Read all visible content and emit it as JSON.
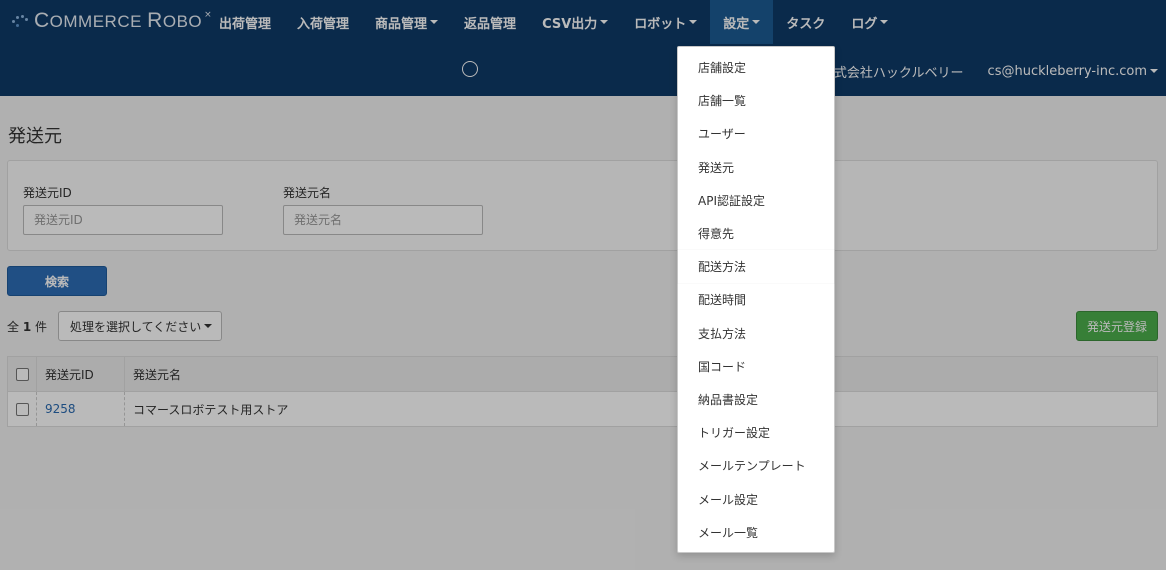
{
  "brand": {
    "name_c": "C",
    "name_rest": "OMMERCE ",
    "name_r": "R",
    "name_rest2": "OBO",
    "mark": "×"
  },
  "nav": {
    "items": [
      {
        "label": "出荷管理",
        "dropdown": false
      },
      {
        "label": "入荷管理",
        "dropdown": false
      },
      {
        "label": "商品管理",
        "dropdown": true
      },
      {
        "label": "返品管理",
        "dropdown": false
      },
      {
        "label": "CSV出力",
        "dropdown": true
      },
      {
        "label": "ロボット",
        "dropdown": true
      },
      {
        "label": "設定",
        "dropdown": true,
        "active": true
      },
      {
        "label": "タスク",
        "dropdown": false
      },
      {
        "label": "ログ",
        "dropdown": true
      }
    ]
  },
  "userbar": {
    "store": "E】株式会社ハックルベリー",
    "email": "cs@huckleberry-inc.com"
  },
  "page": {
    "title": "発送元"
  },
  "search": {
    "id_label": "発送元ID",
    "id_placeholder": "発送元ID",
    "name_label": "発送元名",
    "name_placeholder": "発送元名",
    "button": "検索"
  },
  "list": {
    "count_prefix": "全",
    "count": "1",
    "count_suffix": "件",
    "bulk_action": "処理を選択してください",
    "register_button": "発送元登録"
  },
  "table": {
    "headers": {
      "id": "発送元ID",
      "name": "発送元名"
    },
    "rows": [
      {
        "id": "9258",
        "name": "コマースロボテスト用ストア"
      }
    ]
  },
  "settings_menu": {
    "items": [
      "店舗設定",
      "店舗一覧",
      "ユーザー",
      "発送元",
      "API認証設定",
      "得意先",
      "配送方法",
      "配送時間",
      "支払方法",
      "国コード",
      "納品書設定",
      "トリガー設定",
      "メールテンプレート",
      "メール設定",
      "メール一覧"
    ],
    "highlighted": "配送方法"
  },
  "colors": {
    "navbar": "#0f3a68",
    "accent": "#2d6db5",
    "success": "#4cae4c",
    "link": "#2a6ab0"
  }
}
